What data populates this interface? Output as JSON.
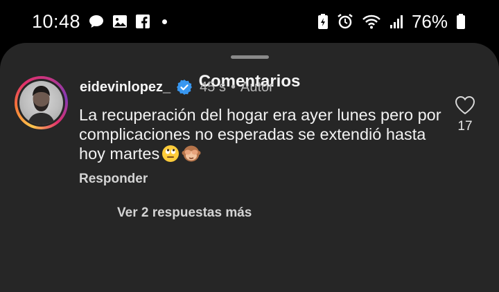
{
  "status_bar": {
    "time": "10:48",
    "battery_percent": "76%",
    "left_icons": [
      "chat-bubble-icon",
      "image-icon",
      "facebook-icon",
      "notification-dot"
    ],
    "right_icons": [
      "battery-saver-icon",
      "alarm-icon",
      "wifi-icon",
      "signal-icon",
      "battery-icon"
    ]
  },
  "sheet": {
    "title": "Comentarios"
  },
  "comment": {
    "username": "eidevinlopez_",
    "verified": true,
    "time": "45 s",
    "separator": "•",
    "author_badge": "Autor",
    "text": "La recuperación del hogar era ayer lunes pero por complicaciones no esperadas se extendió hasta hoy martes",
    "emojis": [
      "eye-roll-emoji-icon",
      "see-no-evil-monkey-emoji-icon"
    ],
    "reply_label": "Responder",
    "like_count": "17"
  },
  "replies": {
    "view_more_label": "Ver 2 respuestas más"
  },
  "colors": {
    "sheet_bg": "#262626",
    "verified_blue": "#3897f0",
    "ring_gradient": [
      "#fdc74d",
      "#f77737",
      "#e1306c",
      "#833ab4"
    ]
  }
}
